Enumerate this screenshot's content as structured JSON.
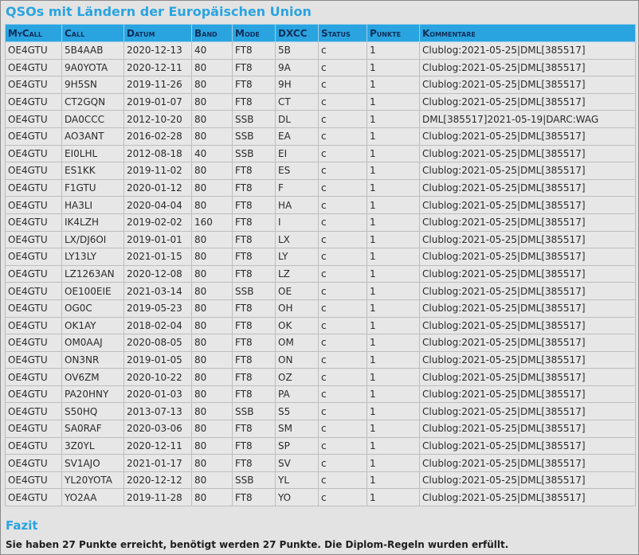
{
  "page": {
    "title": "QSOs mit Ländern der Europäischen Union"
  },
  "colors": {
    "accent": "#2aa4e0",
    "header_text": "#0d2f5a",
    "background": "#e3e3e3"
  },
  "table": {
    "headers": [
      "MyCall",
      "Call",
      "Datum",
      "Band",
      "Mode",
      "DXCC",
      "Status",
      "Punkte",
      "Kommentare"
    ],
    "rows": [
      [
        "OE4GTU",
        "5B4AAB",
        "2020-12-13",
        "40",
        "FT8",
        "5B",
        "c",
        "1",
        "Clublog:2021-05-25|DML[385517]"
      ],
      [
        "OE4GTU",
        "9A0YOTA",
        "2020-12-11",
        "80",
        "FT8",
        "9A",
        "c",
        "1",
        "Clublog:2021-05-25|DML[385517]"
      ],
      [
        "OE4GTU",
        "9H5SN",
        "2019-11-26",
        "80",
        "FT8",
        "9H",
        "c",
        "1",
        "Clublog:2021-05-25|DML[385517]"
      ],
      [
        "OE4GTU",
        "CT2GQN",
        "2019-01-07",
        "80",
        "FT8",
        "CT",
        "c",
        "1",
        "Clublog:2021-05-25|DML[385517]"
      ],
      [
        "OE4GTU",
        "DA0CCC",
        "2012-10-20",
        "80",
        "SSB",
        "DL",
        "c",
        "1",
        "DML[385517]2021-05-19|DARC:WAG"
      ],
      [
        "OE4GTU",
        "AO3ANT",
        "2016-02-28",
        "80",
        "SSB",
        "EA",
        "c",
        "1",
        "Clublog:2021-05-25|DML[385517]"
      ],
      [
        "OE4GTU",
        "EI0LHL",
        "2012-08-18",
        "40",
        "SSB",
        "EI",
        "c",
        "1",
        "Clublog:2021-05-25|DML[385517]"
      ],
      [
        "OE4GTU",
        "ES1KK",
        "2019-11-02",
        "80",
        "FT8",
        "ES",
        "c",
        "1",
        "Clublog:2021-05-25|DML[385517]"
      ],
      [
        "OE4GTU",
        "F1GTU",
        "2020-01-12",
        "80",
        "FT8",
        "F",
        "c",
        "1",
        "Clublog:2021-05-25|DML[385517]"
      ],
      [
        "OE4GTU",
        "HA3LI",
        "2020-04-04",
        "80",
        "FT8",
        "HA",
        "c",
        "1",
        "Clublog:2021-05-25|DML[385517]"
      ],
      [
        "OE4GTU",
        "IK4LZH",
        "2019-02-02",
        "160",
        "FT8",
        "I",
        "c",
        "1",
        "Clublog:2021-05-25|DML[385517]"
      ],
      [
        "OE4GTU",
        "LX/DJ6OI",
        "2019-01-01",
        "80",
        "FT8",
        "LX",
        "c",
        "1",
        "Clublog:2021-05-25|DML[385517]"
      ],
      [
        "OE4GTU",
        "LY13LY",
        "2021-01-15",
        "80",
        "FT8",
        "LY",
        "c",
        "1",
        "Clublog:2021-05-25|DML[385517]"
      ],
      [
        "OE4GTU",
        "LZ1263AN",
        "2020-12-08",
        "80",
        "FT8",
        "LZ",
        "c",
        "1",
        "Clublog:2021-05-25|DML[385517]"
      ],
      [
        "OE4GTU",
        "OE100EIE",
        "2021-03-14",
        "80",
        "SSB",
        "OE",
        "c",
        "1",
        "Clublog:2021-05-25|DML[385517]"
      ],
      [
        "OE4GTU",
        "OG0C",
        "2019-05-23",
        "80",
        "FT8",
        "OH",
        "c",
        "1",
        "Clublog:2021-05-25|DML[385517]"
      ],
      [
        "OE4GTU",
        "OK1AY",
        "2018-02-04",
        "80",
        "FT8",
        "OK",
        "c",
        "1",
        "Clublog:2021-05-25|DML[385517]"
      ],
      [
        "OE4GTU",
        "OM0AAJ",
        "2020-08-05",
        "80",
        "FT8",
        "OM",
        "c",
        "1",
        "Clublog:2021-05-25|DML[385517]"
      ],
      [
        "OE4GTU",
        "ON3NR",
        "2019-01-05",
        "80",
        "FT8",
        "ON",
        "c",
        "1",
        "Clublog:2021-05-25|DML[385517]"
      ],
      [
        "OE4GTU",
        "OV6ZM",
        "2020-10-22",
        "80",
        "FT8",
        "OZ",
        "c",
        "1",
        "Clublog:2021-05-25|DML[385517]"
      ],
      [
        "OE4GTU",
        "PA20HNY",
        "2020-01-03",
        "80",
        "FT8",
        "PA",
        "c",
        "1",
        "Clublog:2021-05-25|DML[385517]"
      ],
      [
        "OE4GTU",
        "S50HQ",
        "2013-07-13",
        "80",
        "SSB",
        "S5",
        "c",
        "1",
        "Clublog:2021-05-25|DML[385517]"
      ],
      [
        "OE4GTU",
        "SA0RAF",
        "2020-03-06",
        "80",
        "FT8",
        "SM",
        "c",
        "1",
        "Clublog:2021-05-25|DML[385517]"
      ],
      [
        "OE4GTU",
        "3Z0YL",
        "2020-12-11",
        "80",
        "FT8",
        "SP",
        "c",
        "1",
        "Clublog:2021-05-25|DML[385517]"
      ],
      [
        "OE4GTU",
        "SV1AJO",
        "2021-01-17",
        "80",
        "FT8",
        "SV",
        "c",
        "1",
        "Clublog:2021-05-25|DML[385517]"
      ],
      [
        "OE4GTU",
        "YL20YOTA",
        "2020-12-12",
        "80",
        "SSB",
        "YL",
        "c",
        "1",
        "Clublog:2021-05-25|DML[385517]"
      ],
      [
        "OE4GTU",
        "YO2AA",
        "2019-11-28",
        "80",
        "FT8",
        "YO",
        "c",
        "1",
        "Clublog:2021-05-25|DML[385517]"
      ]
    ]
  },
  "fazit": {
    "heading": "Fazit",
    "text": "Sie haben 27 Punkte erreicht, benötigt werden 27 Punkte. Die Diplom-Regeln wurden erfüllt."
  }
}
